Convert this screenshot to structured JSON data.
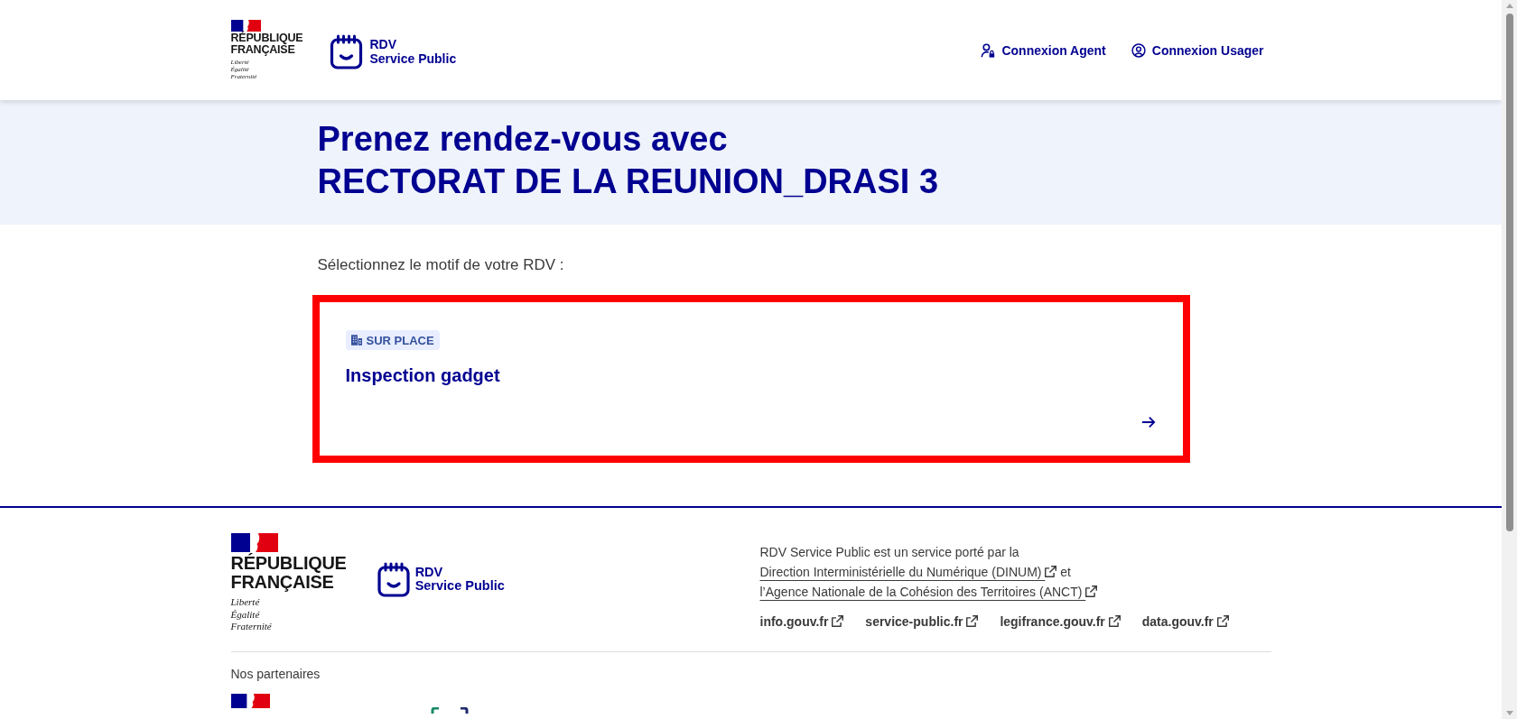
{
  "header": {
    "brand": {
      "name_lines": [
        "RÉPUBLIQUE",
        "FRANÇAISE"
      ],
      "motto_lines": [
        "Liberté",
        "Égalité",
        "Fraternité"
      ]
    },
    "service": {
      "name_lines": [
        "RDV",
        "Service Public"
      ]
    },
    "links": [
      {
        "label": "Connexion Agent",
        "kind": "agent"
      },
      {
        "label": "Connexion Usager",
        "kind": "user"
      }
    ]
  },
  "hero": {
    "title_lines": [
      "Prenez rendez-vous avec",
      "RECTORAT DE LA REUNION_DRASI 3"
    ]
  },
  "motives_section": {
    "prompt": "Sélectionnez le motif de votre RDV :",
    "motives": [
      {
        "badge": {
          "label": "SUR PLACE",
          "kind": "on_site"
        },
        "title": "Inspection gadget",
        "highlighted": true
      }
    ]
  },
  "footer": {
    "brand": {
      "name_lines": [
        "RÉPUBLIQUE",
        "FRANÇAISE"
      ],
      "motto_lines": [
        "Liberté",
        "Égalité",
        "Fraternité"
      ]
    },
    "service": {
      "name_lines": [
        "RDV",
        "Service Public"
      ]
    },
    "description": [
      {
        "kind": "text",
        "text": "RDV Service Public est un service porté par la "
      },
      {
        "kind": "link",
        "text": "Direction Interministérielle du Numérique (DINUM)"
      },
      {
        "kind": "text",
        "text": " et "
      },
      {
        "kind": "link",
        "text": "l’Agence Nationale de la Cohésion des Territoires (ANCT)"
      }
    ],
    "links": [
      {
        "label": "info.gouv.fr"
      },
      {
        "label": "service-public.fr"
      },
      {
        "label": "legifrance.gouv.fr"
      },
      {
        "label": "data.gouv.fr"
      }
    ],
    "partners": {
      "heading": "Nos partenaires"
    }
  }
}
